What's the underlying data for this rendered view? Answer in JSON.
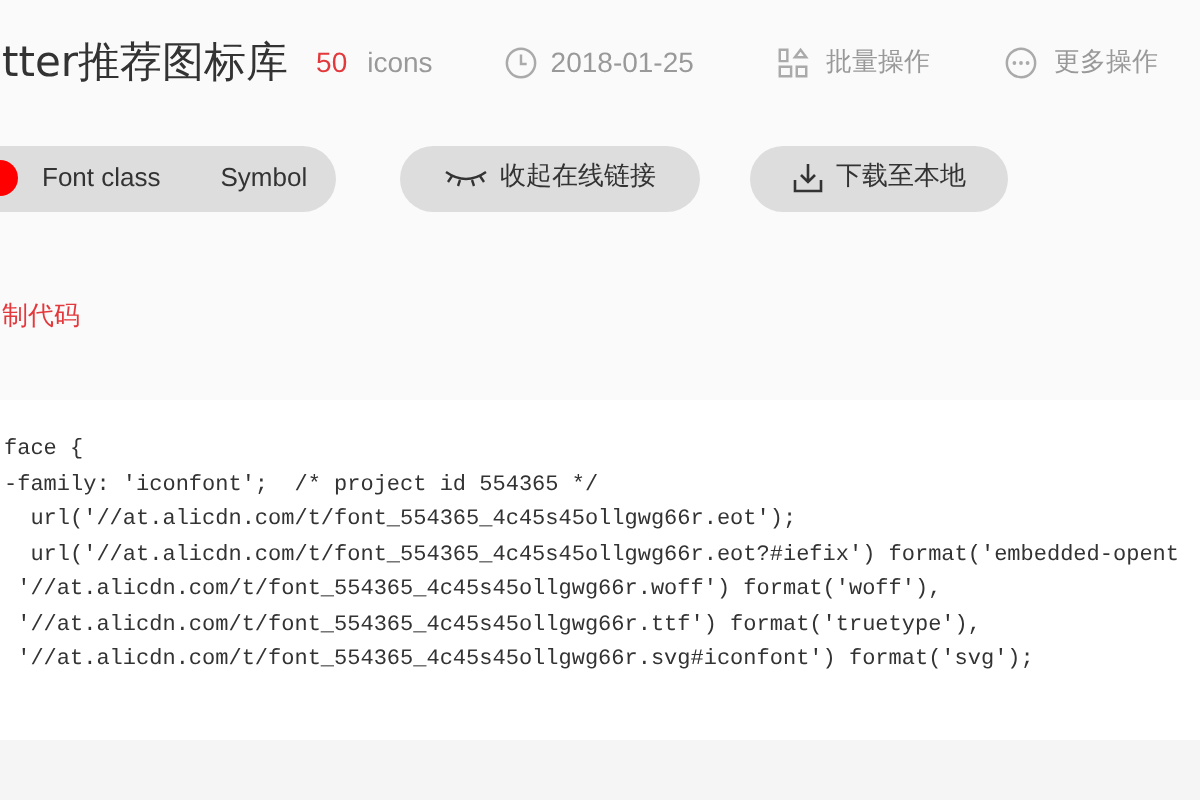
{
  "header": {
    "title": "tter推荐图标库",
    "count": "50",
    "count_unit": "icons",
    "date": "2018-01-25",
    "actions": [
      {
        "kind": "batch",
        "label": "批量操作"
      },
      {
        "kind": "more",
        "label": "更多操作"
      }
    ]
  },
  "tabs": [
    {
      "selected": true
    },
    {
      "label": "Font class",
      "selected": false
    },
    {
      "label": "Symbol",
      "selected": false
    }
  ],
  "buttons": [
    {
      "kind": "collapse",
      "label": "收起在线链接"
    },
    {
      "kind": "download",
      "label": "下载至本地"
    }
  ],
  "copy_link": "制代码",
  "code_lines": [
    "face {",
    "-family: 'iconfont';  /* project id 554365 */",
    "  url('//at.alicdn.com/t/font_554365_4c45s45ollgwg66r.eot');",
    "  url('//at.alicdn.com/t/font_554365_4c45s45ollgwg66r.eot?#iefix') format('embedded-opent",
    " '//at.alicdn.com/t/font_554365_4c45s45ollgwg66r.woff') format('woff'),",
    " '//at.alicdn.com/t/font_554365_4c45s45ollgwg66r.ttf') format('truetype'),",
    " '//at.alicdn.com/t/font_554365_4c45s45ollgwg66r.svg#iconfont') format('svg');"
  ]
}
